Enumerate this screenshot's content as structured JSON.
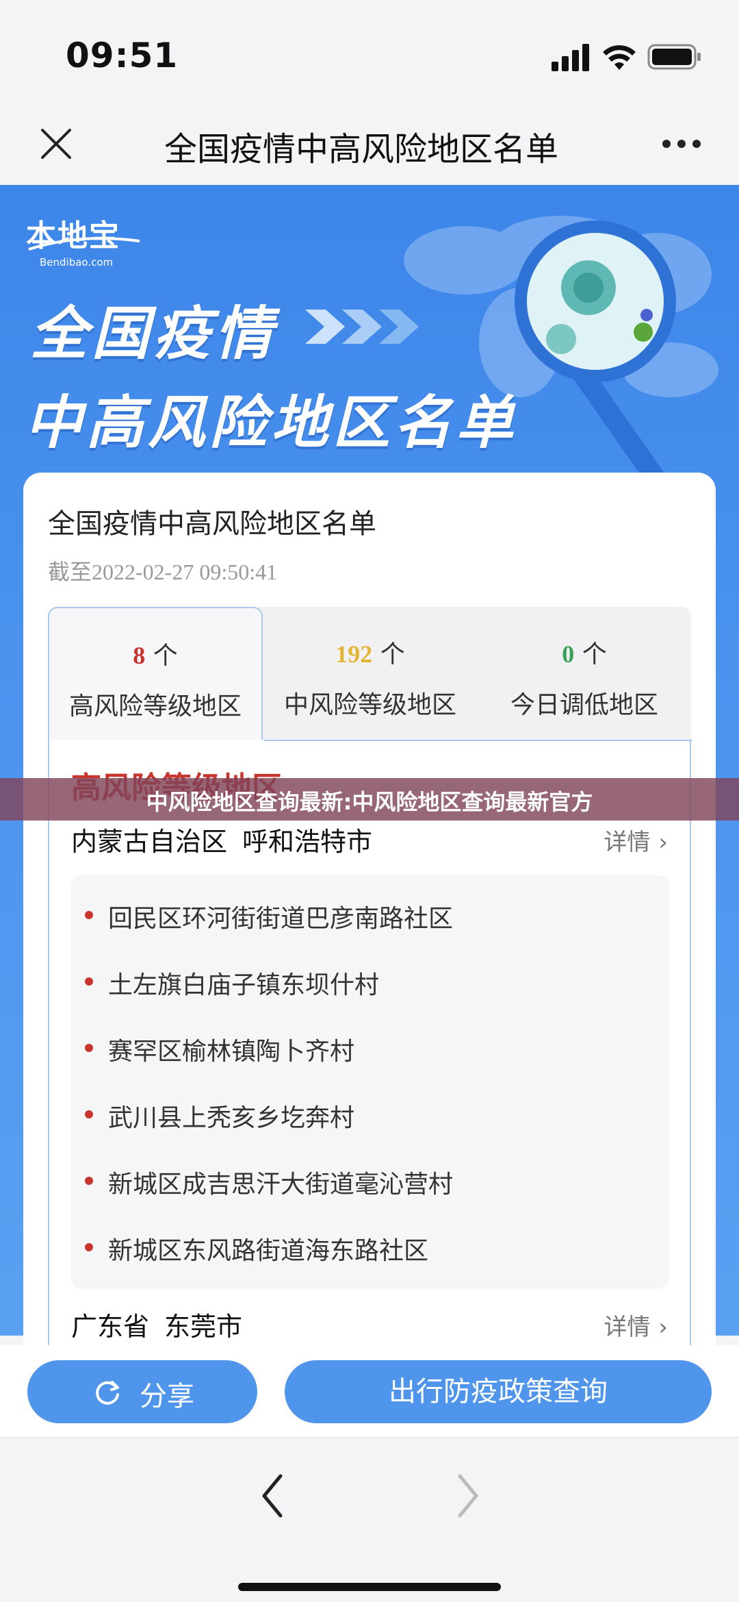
{
  "status_bar": {
    "time": "09:51"
  },
  "nav": {
    "title": "全国疫情中高风险地区名单"
  },
  "banner": {
    "logo_cn": "本地宝",
    "logo_en": "Bendibao.com",
    "line1": "全国疫情",
    "line2": "中高风险地区名单"
  },
  "card": {
    "title": "全国疫情中高风险地区名单",
    "updated_prefix": "截至",
    "updated_time": "2022-02-27 09:50:41",
    "tabs": [
      {
        "count": "8",
        "unit": "个",
        "label": "高风险等级地区",
        "color": "#c8352e"
      },
      {
        "count": "192",
        "unit": "个",
        "label": "中风险等级地区",
        "color": "#e3b534"
      },
      {
        "count": "0",
        "unit": "个",
        "label": "今日调低地区",
        "color": "#3ca055"
      }
    ],
    "section_title": "高风险等级地区",
    "groups": [
      {
        "province": "内蒙古自治区",
        "city": "呼和浩特市",
        "detail": "详情",
        "items": [
          "回民区环河街街道巴彦南路社区",
          "土左旗白庙子镇东坝什村",
          "赛罕区榆林镇陶卜齐村",
          "武川县上秃亥乡圪奔村",
          "新城区成吉思汗大街道毫沁营村",
          "新城区东风路街道海东路社区"
        ]
      },
      {
        "province": "广东省",
        "city": "东莞市",
        "detail": "详情",
        "items": []
      }
    ]
  },
  "overlay_caption": "中风险地区查询最新:中风险地区查询最新官方",
  "actions": {
    "share": "分享",
    "policy": "出行防疫政策查询"
  },
  "colors": {
    "accent": "#4f95ec",
    "high_risk": "#c8352e",
    "medium_risk": "#e3b534",
    "lowered": "#3ca055"
  }
}
